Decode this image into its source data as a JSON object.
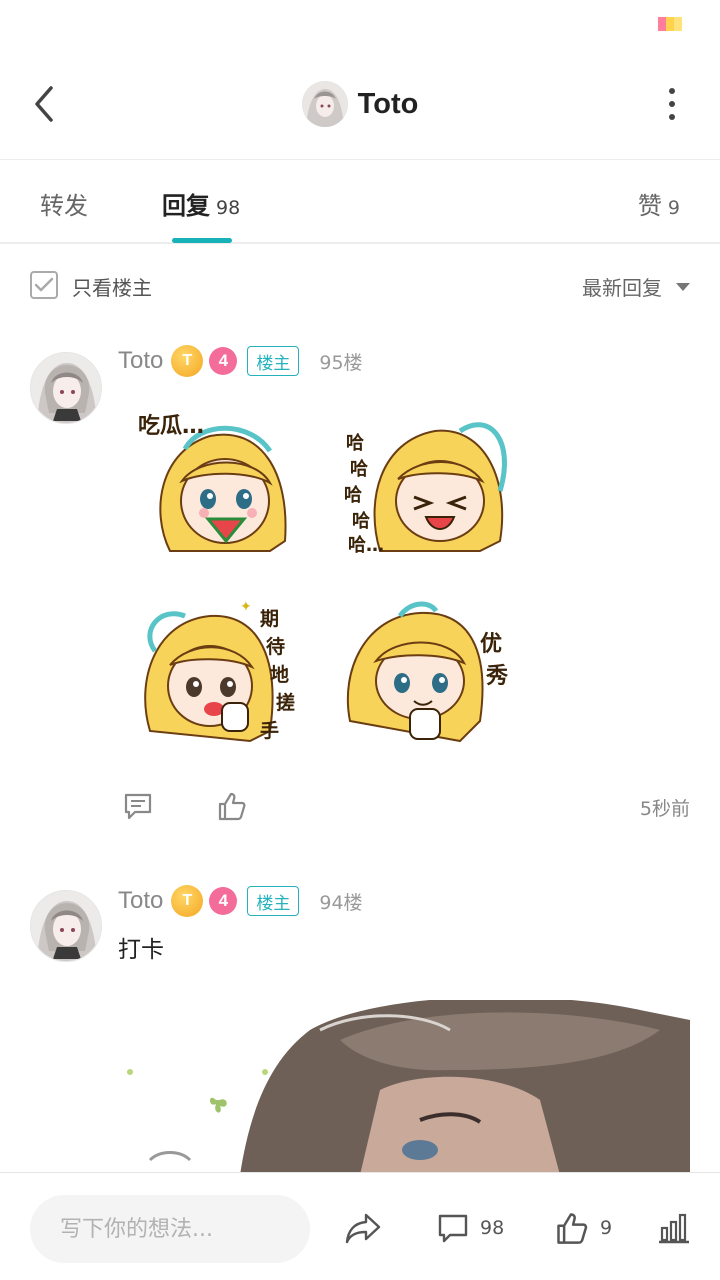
{
  "status": {
    "colors": [
      "#ff7e9b",
      "#ffd34e"
    ]
  },
  "header": {
    "title": "Toto",
    "back_icon": "chevron-left-icon",
    "more_icon": "more-vertical-icon"
  },
  "tabs": [
    {
      "label": "转发",
      "count": ""
    },
    {
      "label": "回复",
      "count": "98"
    },
    {
      "label": "赞",
      "count": "9"
    }
  ],
  "active_tab": "回复",
  "filter": {
    "only_op_label": "只看楼主",
    "sort_label": "最新回复"
  },
  "posts": [
    {
      "username": "Toto",
      "coin_badge": "T",
      "level": "4",
      "op_badge": "楼主",
      "floor": "95楼",
      "stickers": [
        {
          "caption": "吃瓜…"
        },
        {
          "caption": "哈哈哈哈哈…"
        },
        {
          "caption": "期待地搓手"
        },
        {
          "caption": "优秀"
        }
      ],
      "time": "5秒前"
    },
    {
      "username": "Toto",
      "coin_badge": "T",
      "level": "4",
      "op_badge": "楼主",
      "floor": "94楼",
      "text": "打卡"
    }
  ],
  "bottom_bar": {
    "input_placeholder": "写下你的想法...",
    "reply_count": "98",
    "like_count": "9"
  },
  "colors": {
    "accent": "#17b2b8",
    "op_badge": "#25b2bd",
    "level_badge": "#f36c9a",
    "coin": "#f4a623"
  }
}
